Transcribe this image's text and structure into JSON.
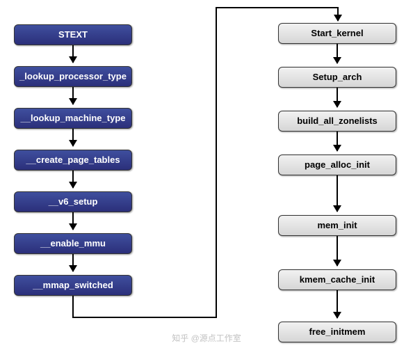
{
  "chart_data": {
    "type": "flowchart",
    "title": "",
    "left_chain": {
      "style": "blue",
      "nodes": [
        "STEXT",
        "_lookup_processor_type",
        "__lookup_machine_type",
        "__create_page_tables",
        "__v6_setup",
        "__enable_mmu",
        "__mmap_switched"
      ]
    },
    "right_chain": {
      "style": "gray",
      "nodes": [
        "Start_kernel",
        "Setup_arch",
        "build_all_zonelists",
        "page_alloc_init",
        "mem_init",
        "kmem_cache_init",
        "free_initmem"
      ]
    },
    "cross_link": {
      "from": "__mmap_switched",
      "to": "Start_kernel",
      "description": "left chain bottom routes up into right chain top"
    }
  },
  "watermark": "知乎 @源点工作室"
}
